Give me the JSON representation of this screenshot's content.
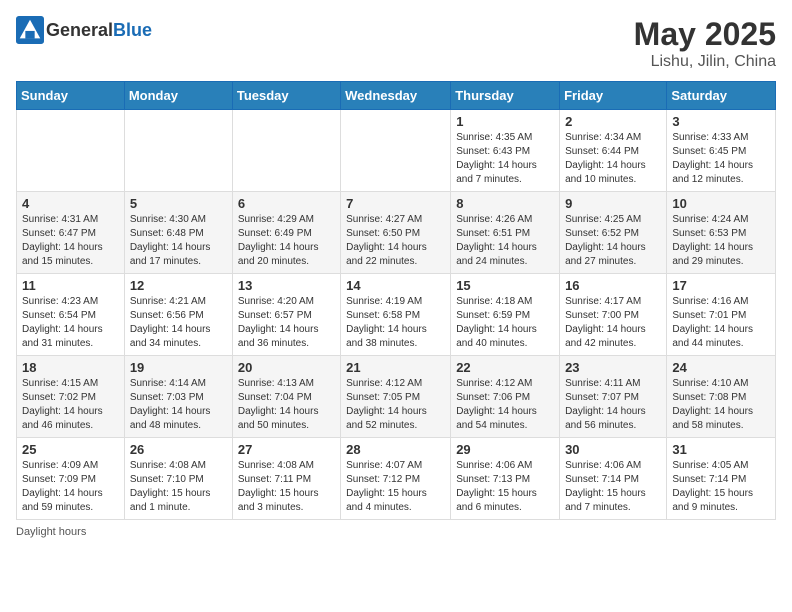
{
  "header": {
    "logo_general": "General",
    "logo_blue": "Blue",
    "month": "May 2025",
    "location": "Lishu, Jilin, China"
  },
  "weekdays": [
    "Sunday",
    "Monday",
    "Tuesday",
    "Wednesday",
    "Thursday",
    "Friday",
    "Saturday"
  ],
  "rows": [
    [
      {
        "day": "",
        "info": ""
      },
      {
        "day": "",
        "info": ""
      },
      {
        "day": "",
        "info": ""
      },
      {
        "day": "",
        "info": ""
      },
      {
        "day": "1",
        "info": "Sunrise: 4:35 AM\nSunset: 6:43 PM\nDaylight: 14 hours\nand 7 minutes."
      },
      {
        "day": "2",
        "info": "Sunrise: 4:34 AM\nSunset: 6:44 PM\nDaylight: 14 hours\nand 10 minutes."
      },
      {
        "day": "3",
        "info": "Sunrise: 4:33 AM\nSunset: 6:45 PM\nDaylight: 14 hours\nand 12 minutes."
      }
    ],
    [
      {
        "day": "4",
        "info": "Sunrise: 4:31 AM\nSunset: 6:47 PM\nDaylight: 14 hours\nand 15 minutes."
      },
      {
        "day": "5",
        "info": "Sunrise: 4:30 AM\nSunset: 6:48 PM\nDaylight: 14 hours\nand 17 minutes."
      },
      {
        "day": "6",
        "info": "Sunrise: 4:29 AM\nSunset: 6:49 PM\nDaylight: 14 hours\nand 20 minutes."
      },
      {
        "day": "7",
        "info": "Sunrise: 4:27 AM\nSunset: 6:50 PM\nDaylight: 14 hours\nand 22 minutes."
      },
      {
        "day": "8",
        "info": "Sunrise: 4:26 AM\nSunset: 6:51 PM\nDaylight: 14 hours\nand 24 minutes."
      },
      {
        "day": "9",
        "info": "Sunrise: 4:25 AM\nSunset: 6:52 PM\nDaylight: 14 hours\nand 27 minutes."
      },
      {
        "day": "10",
        "info": "Sunrise: 4:24 AM\nSunset: 6:53 PM\nDaylight: 14 hours\nand 29 minutes."
      }
    ],
    [
      {
        "day": "11",
        "info": "Sunrise: 4:23 AM\nSunset: 6:54 PM\nDaylight: 14 hours\nand 31 minutes."
      },
      {
        "day": "12",
        "info": "Sunrise: 4:21 AM\nSunset: 6:56 PM\nDaylight: 14 hours\nand 34 minutes."
      },
      {
        "day": "13",
        "info": "Sunrise: 4:20 AM\nSunset: 6:57 PM\nDaylight: 14 hours\nand 36 minutes."
      },
      {
        "day": "14",
        "info": "Sunrise: 4:19 AM\nSunset: 6:58 PM\nDaylight: 14 hours\nand 38 minutes."
      },
      {
        "day": "15",
        "info": "Sunrise: 4:18 AM\nSunset: 6:59 PM\nDaylight: 14 hours\nand 40 minutes."
      },
      {
        "day": "16",
        "info": "Sunrise: 4:17 AM\nSunset: 7:00 PM\nDaylight: 14 hours\nand 42 minutes."
      },
      {
        "day": "17",
        "info": "Sunrise: 4:16 AM\nSunset: 7:01 PM\nDaylight: 14 hours\nand 44 minutes."
      }
    ],
    [
      {
        "day": "18",
        "info": "Sunrise: 4:15 AM\nSunset: 7:02 PM\nDaylight: 14 hours\nand 46 minutes."
      },
      {
        "day": "19",
        "info": "Sunrise: 4:14 AM\nSunset: 7:03 PM\nDaylight: 14 hours\nand 48 minutes."
      },
      {
        "day": "20",
        "info": "Sunrise: 4:13 AM\nSunset: 7:04 PM\nDaylight: 14 hours\nand 50 minutes."
      },
      {
        "day": "21",
        "info": "Sunrise: 4:12 AM\nSunset: 7:05 PM\nDaylight: 14 hours\nand 52 minutes."
      },
      {
        "day": "22",
        "info": "Sunrise: 4:12 AM\nSunset: 7:06 PM\nDaylight: 14 hours\nand 54 minutes."
      },
      {
        "day": "23",
        "info": "Sunrise: 4:11 AM\nSunset: 7:07 PM\nDaylight: 14 hours\nand 56 minutes."
      },
      {
        "day": "24",
        "info": "Sunrise: 4:10 AM\nSunset: 7:08 PM\nDaylight: 14 hours\nand 58 minutes."
      }
    ],
    [
      {
        "day": "25",
        "info": "Sunrise: 4:09 AM\nSunset: 7:09 PM\nDaylight: 14 hours\nand 59 minutes."
      },
      {
        "day": "26",
        "info": "Sunrise: 4:08 AM\nSunset: 7:10 PM\nDaylight: 15 hours\nand 1 minute."
      },
      {
        "day": "27",
        "info": "Sunrise: 4:08 AM\nSunset: 7:11 PM\nDaylight: 15 hours\nand 3 minutes."
      },
      {
        "day": "28",
        "info": "Sunrise: 4:07 AM\nSunset: 7:12 PM\nDaylight: 15 hours\nand 4 minutes."
      },
      {
        "day": "29",
        "info": "Sunrise: 4:06 AM\nSunset: 7:13 PM\nDaylight: 15 hours\nand 6 minutes."
      },
      {
        "day": "30",
        "info": "Sunrise: 4:06 AM\nSunset: 7:14 PM\nDaylight: 15 hours\nand 7 minutes."
      },
      {
        "day": "31",
        "info": "Sunrise: 4:05 AM\nSunset: 7:14 PM\nDaylight: 15 hours\nand 9 minutes."
      }
    ]
  ],
  "footer": {
    "note": "Daylight hours"
  }
}
